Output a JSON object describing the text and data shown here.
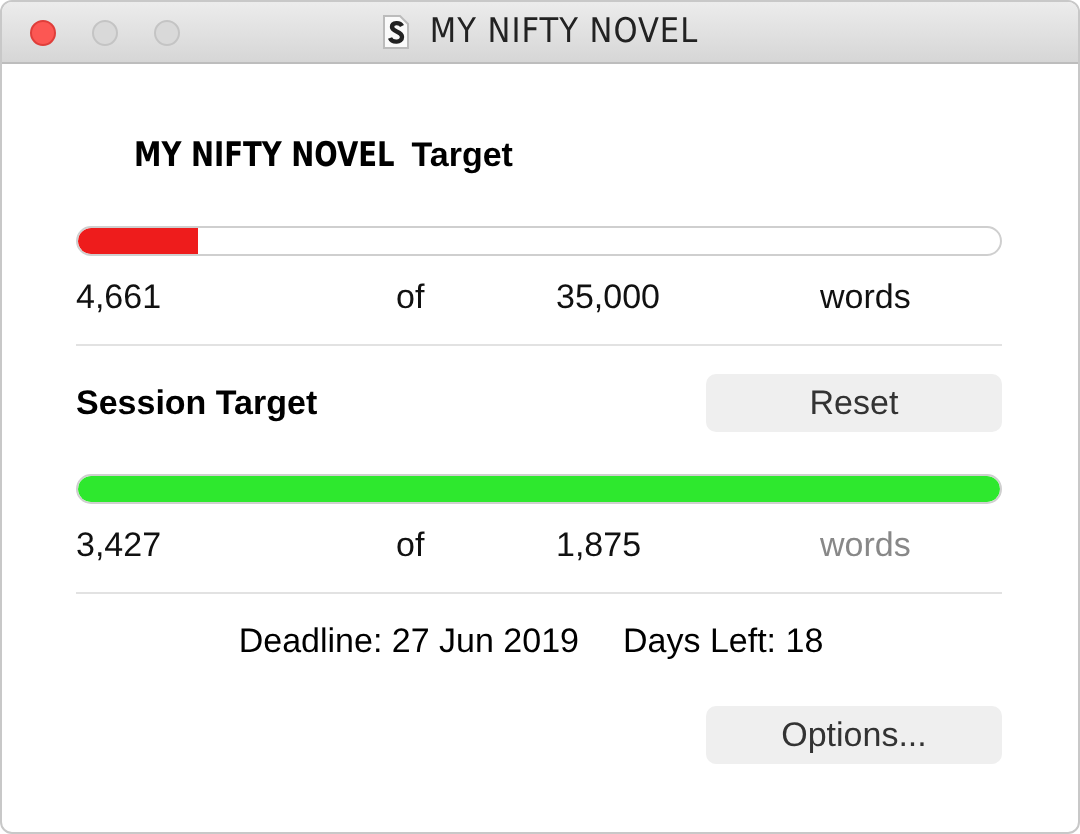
{
  "window": {
    "title": "MY NIFTY NOVEL",
    "controls": [
      {
        "active": true
      },
      {
        "active": false
      },
      {
        "active": false
      }
    ]
  },
  "project_target": {
    "name": "MY NIFTY NOVEL",
    "label": "Target",
    "level": 0.13,
    "color": "#ee1c1c",
    "count": "4,661",
    "of": "of",
    "goal": "35,000",
    "unit": "words",
    "unit_dimmed": false
  },
  "session_target": {
    "label": "Session Target",
    "button": "Reset",
    "level": 1,
    "color": "#2ee82e",
    "count": "3,427",
    "of": "of",
    "goal": "1,875",
    "unit": "words",
    "unit_dimmed": true
  },
  "deadline": {
    "text": "Deadline: 27 Jun 2019",
    "days_left": "Days Left: 18"
  },
  "buttons": [
    "Options..."
  ]
}
